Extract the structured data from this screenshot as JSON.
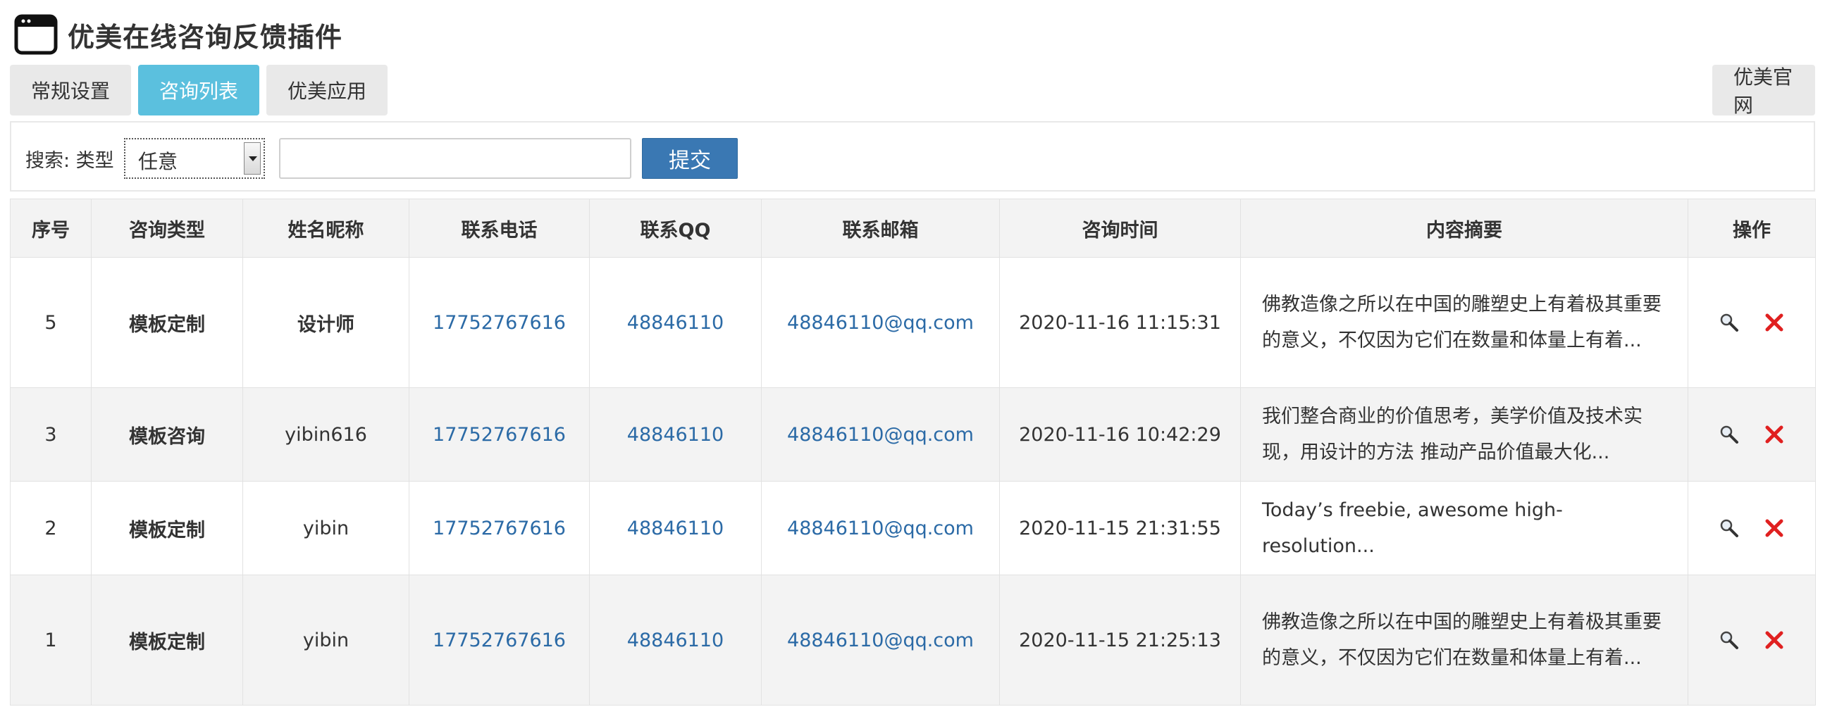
{
  "header": {
    "title": "优美在线咨询反馈插件",
    "icon": "window-icon"
  },
  "tabs": [
    {
      "label": "常规设置",
      "active": false
    },
    {
      "label": "咨询列表",
      "active": true
    },
    {
      "label": "优美应用",
      "active": false
    }
  ],
  "official_label": "优美官网",
  "search": {
    "label": "搜索: 类型",
    "type_selected": "任意",
    "input_value": "",
    "input_placeholder": "",
    "submit_label": "提交"
  },
  "table": {
    "columns": [
      "序号",
      "咨询类型",
      "姓名昵称",
      "联系电话",
      "联系QQ",
      "联系邮箱",
      "咨询时间",
      "内容摘要",
      "操作"
    ],
    "rows": [
      {
        "id": "5",
        "type": "模板定制",
        "name": "设计师",
        "phone": "17752767616",
        "qq": "48846110",
        "email": "48846110@qq.com",
        "time": "2020-11-16 11:15:31",
        "summary": "佛教造像之所以在中国的雕塑史上有着极其重要的意义，不仅因为它们在数量和体量上有着..."
      },
      {
        "id": "3",
        "type": "模板咨询",
        "name": "yibin616",
        "phone": "17752767616",
        "qq": "48846110",
        "email": "48846110@qq.com",
        "time": "2020-11-16 10:42:29",
        "summary": "我们整合商业的价值思考，美学价值及技术实现，用设计的方法 推动产品价值最大化..."
      },
      {
        "id": "2",
        "type": "模板定制",
        "name": "yibin",
        "phone": "17752767616",
        "qq": "48846110",
        "email": "48846110@qq.com",
        "time": "2020-11-15 21:31:55",
        "summary": "Today’s freebie, awesome high-resolution..."
      },
      {
        "id": "1",
        "type": "模板定制",
        "name": "yibin",
        "phone": "17752767616",
        "qq": "48846110",
        "email": "48846110@qq.com",
        "time": "2020-11-15 21:25:13",
        "summary": "佛教造像之所以在中国的雕塑史上有着极其重要的意义，不仅因为它们在数量和体量上有着..."
      }
    ],
    "op_icons": [
      "magnifier-icon",
      "delete-x-icon"
    ]
  },
  "colors": {
    "accent": "#5bc0de",
    "link": "#2b6aa6",
    "submit": "#3a78b3",
    "delete": "#e02020"
  }
}
